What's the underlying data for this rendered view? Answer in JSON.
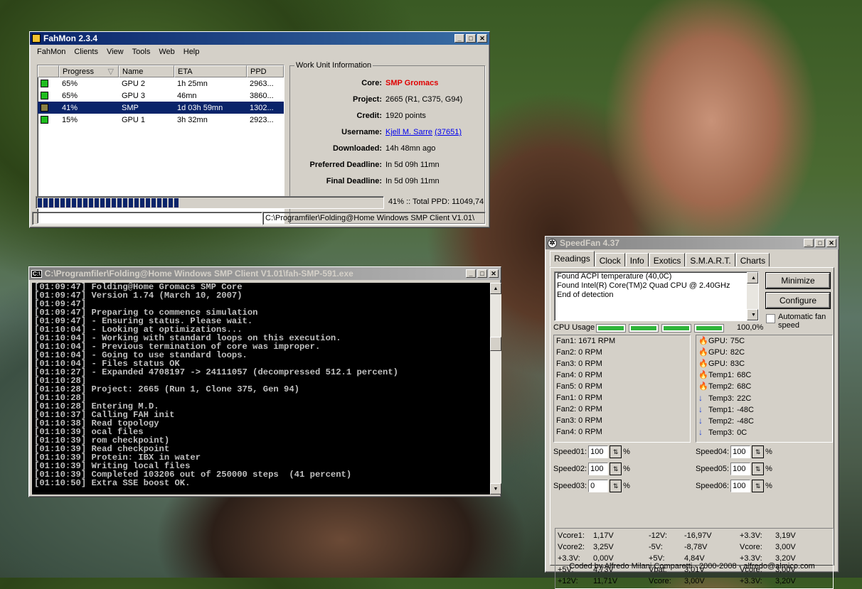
{
  "fahmon": {
    "title": "FahMon 2.3.4",
    "menu": [
      "FahMon",
      "Clients",
      "View",
      "Tools",
      "Web",
      "Help"
    ],
    "columns": [
      "",
      "Progress",
      "Name",
      "ETA",
      "PPD"
    ],
    "rows": [
      {
        "progress": "65%",
        "name": "GPU 2",
        "eta": "1h 25mn",
        "ppd": "2963...",
        "status_color": "#1ebc1e"
      },
      {
        "progress": "65%",
        "name": "GPU 3",
        "eta": "46mn",
        "ppd": "3860...",
        "status_color": "#1ebc1e"
      },
      {
        "progress": "41%",
        "name": "SMP",
        "eta": "1d 03h 59mn",
        "ppd": "1302...",
        "status_color": "#8a8044"
      },
      {
        "progress": "15%",
        "name": "GPU 1",
        "eta": "3h 32mn",
        "ppd": "2923...",
        "status_color": "#1ebc1e"
      }
    ],
    "wui": {
      "legend": "Work Unit Information",
      "core_label": "Core:",
      "core_value": "SMP Gromacs",
      "project_label": "Project:",
      "project_value": "2665 (R1, C375, G94)",
      "credit_label": "Credit:",
      "credit_value": "1920 points",
      "username_label": "Username:",
      "username_value": "Kjell M. Sarre",
      "team_value": "(37651)",
      "downloaded_label": "Downloaded:",
      "downloaded_value": "14h 48mn ago",
      "pref_label": "Preferred Deadline:",
      "pref_value": "In 5d 09h 11mn",
      "final_label": "Final Deadline:",
      "final_value": "In 5d 09h 11mn"
    },
    "progress_fraction": 0.41,
    "progress_text": "41% :: Total PPD: 11049,74",
    "status_path": "C:\\Programfiler\\Folding@Home Windows SMP Client V1.01\\"
  },
  "console": {
    "title": "C:\\Programfiler\\Folding@Home Windows SMP Client V1.01\\fah-SMP-591.exe",
    "icon_text": "C:\\",
    "lines": [
      "[01:09:47] Folding@Home Gromacs SMP Core",
      "[01:09:47] Version 1.74 (March 10, 2007)",
      "[01:09:47]",
      "[01:09:47] Preparing to commence simulation",
      "[01:09:47] - Ensuring status. Please wait.",
      "[01:10:04] - Looking at optimizations...",
      "[01:10:04] - Working with standard loops on this execution.",
      "[01:10:04] - Previous termination of core was improper.",
      "[01:10:04] - Going to use standard loops.",
      "[01:10:04] - Files status OK",
      "[01:10:27] - Expanded 4708197 -> 24111057 (decompressed 512.1 percent)",
      "[01:10:28]",
      "[01:10:28] Project: 2665 (Run 1, Clone 375, Gen 94)",
      "[01:10:28]",
      "[01:10:28] Entering M.D.",
      "[01:10:37] Calling FAH init",
      "[01:10:38] Read topology",
      "[01:10:39] ocal files",
      "[01:10:39] rom checkpoint)",
      "[01:10:39] Read checkpoint",
      "[01:10:39] Protein: IBX in water",
      "[01:10:39] Writing local files",
      "[01:10:39] Completed 103206 out of 250000 steps  (41 percent)",
      "[01:10:50] Extra SSE boost OK."
    ]
  },
  "speedfan": {
    "title": "SpeedFan 4.37",
    "tabs": [
      "Readings",
      "Clock",
      "Info",
      "Exotics",
      "S.M.A.R.T.",
      "Charts"
    ],
    "log": [
      "Found ACPI temperature (40,0C)",
      "Found Intel(R) Core(TM)2 Quad CPU @ 2.40GHz",
      "End of detection"
    ],
    "minimize_label": "Minimize",
    "configure_label": "Configure",
    "auto_fan_label": "Automatic fan speed",
    "cpu_usage_label": "CPU Usage",
    "cpu_usage_value": "100,0%",
    "fans": [
      "Fan1: 1671 RPM",
      "Fan2: 0 RPM",
      "Fan3: 0 RPM",
      "Fan4: 0 RPM",
      "Fan5: 0 RPM",
      "Fan1: 0 RPM",
      "Fan2: 0 RPM",
      "Fan3: 0 RPM",
      "Fan4: 0 RPM"
    ],
    "temps": [
      {
        "label": "GPU:",
        "value": "75C",
        "icon": "flame-icon"
      },
      {
        "label": "GPU:",
        "value": "82C",
        "icon": "flame-icon"
      },
      {
        "label": "GPU:",
        "value": "83C",
        "icon": "flame-icon"
      },
      {
        "label": "Temp1:",
        "value": "68C",
        "icon": "flame-icon"
      },
      {
        "label": "Temp2:",
        "value": "68C",
        "icon": "flame-icon"
      },
      {
        "label": "Temp3:",
        "value": "22C",
        "icon": "down-arrow-icon"
      },
      {
        "label": "Temp1:",
        "value": "-48C",
        "icon": "down-arrow-icon"
      },
      {
        "label": "Temp2:",
        "value": "-48C",
        "icon": "down-arrow-icon"
      },
      {
        "label": "Temp3:",
        "value": "0C",
        "icon": "down-arrow-icon"
      }
    ],
    "speeds": [
      {
        "label": "Speed01:",
        "value": "100"
      },
      {
        "label": "Speed02:",
        "value": "100"
      },
      {
        "label": "Speed03:",
        "value": "0"
      },
      {
        "label": "Speed04:",
        "value": "100"
      },
      {
        "label": "Speed05:",
        "value": "100"
      },
      {
        "label": "Speed06:",
        "value": "100"
      }
    ],
    "percent_sign": "%",
    "voltages": [
      [
        {
          "k": "Vcore1:",
          "v": "1,17V"
        },
        {
          "k": "Vcore2:",
          "v": "3,25V"
        },
        {
          "k": "+3.3V:",
          "v": "0,00V"
        },
        {
          "k": "+5V:",
          "v": "4,73V"
        },
        {
          "k": "+12V:",
          "v": "11,71V"
        }
      ],
      [
        {
          "k": "-12V:",
          "v": "-16,97V"
        },
        {
          "k": "-5V:",
          "v": "-8,78V"
        },
        {
          "k": "+5V:",
          "v": "4,84V"
        },
        {
          "k": "Vbat:",
          "v": "3,01V"
        },
        {
          "k": "Vcore:",
          "v": "3,00V"
        }
      ],
      [
        {
          "k": "+3.3V:",
          "v": "3,19V"
        },
        {
          "k": "Vcore:",
          "v": "3,00V"
        },
        {
          "k": "+3.3V:",
          "v": "3,20V"
        },
        {
          "k": "Vcore:",
          "v": "3,00V"
        },
        {
          "k": "+3.3V:",
          "v": "3,20V"
        }
      ]
    ],
    "footer": "Coded by Alfredo Milani Comparetti - 2000-2008 - alfredo@almico.com"
  }
}
